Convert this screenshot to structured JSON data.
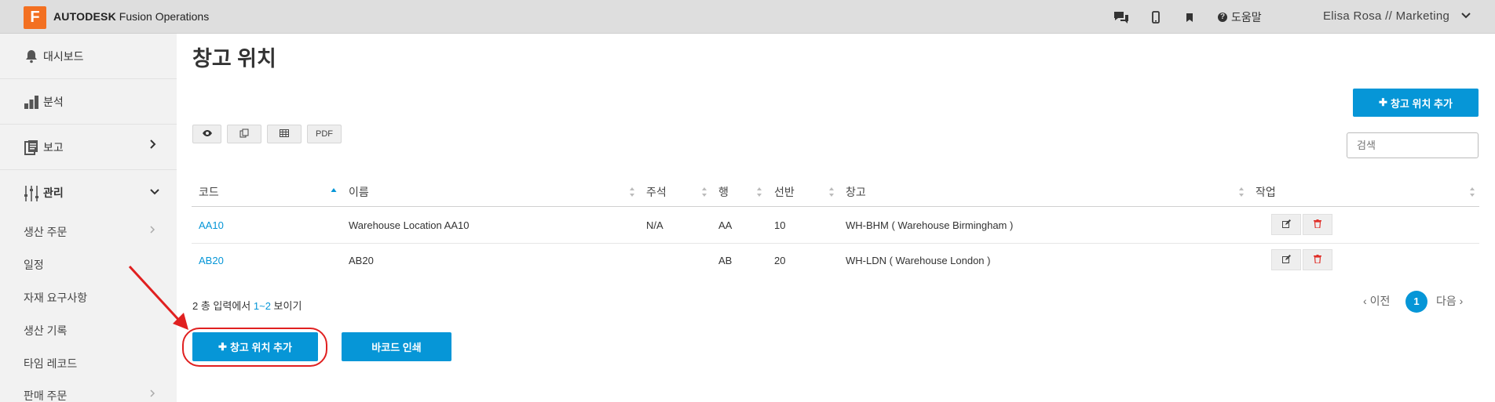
{
  "header": {
    "logo_letter": "F",
    "brand_bold": "AUTODESK",
    "brand_rest": "Fusion Operations",
    "help_label": "도움말",
    "help_icon_char": "?",
    "user": "Elisa Rosa // Marketing",
    "icons": [
      "chat-icon",
      "mobile-icon",
      "bookmark-icon",
      "help-icon",
      "chevron-down-icon"
    ]
  },
  "sidebar": {
    "main": [
      {
        "label": "대시보드",
        "icon": "bell-icon"
      },
      {
        "label": "분석",
        "icon": "bar-chart-icon"
      },
      {
        "label": "보고",
        "icon": "report-icon"
      },
      {
        "label": "관리",
        "icon": "sliders-icon"
      }
    ],
    "sub": [
      "생산 주문",
      "일정",
      "자재 요구사항",
      "생산 기록",
      "타임 레코드",
      "판매 주문"
    ]
  },
  "page": {
    "title": "창고 위치",
    "add_top_label": "창고 위치 추가",
    "search_placeholder": "검색",
    "export_buttons": {
      "pdf": "PDF"
    }
  },
  "table": {
    "columns": [
      "코드",
      "이름",
      "주석",
      "행",
      "선반",
      "창고",
      "작업"
    ],
    "rows": [
      {
        "code": "AA10",
        "name": "Warehouse Location AA10",
        "note": "N/A",
        "row": "AA",
        "shelf": "10",
        "warehouse": "WH-BHM ( Warehouse Birmingham )"
      },
      {
        "code": "AB20",
        "name": "AB20",
        "note": "",
        "row": "AB",
        "shelf": "20",
        "warehouse": "WH-LDN ( Warehouse London )"
      }
    ]
  },
  "footer": {
    "info_a": "2 총 입력에서 ",
    "info_b": "1~2",
    "info_c": " 보이기",
    "prev": "이전",
    "page": "1",
    "next": "다음",
    "add_bottom_label": "창고 위치 추가",
    "barcode_label": "바코드 인쇄"
  },
  "colors": {
    "accent": "#0696d7",
    "logo": "#f37021",
    "annotation": "#e02020"
  }
}
